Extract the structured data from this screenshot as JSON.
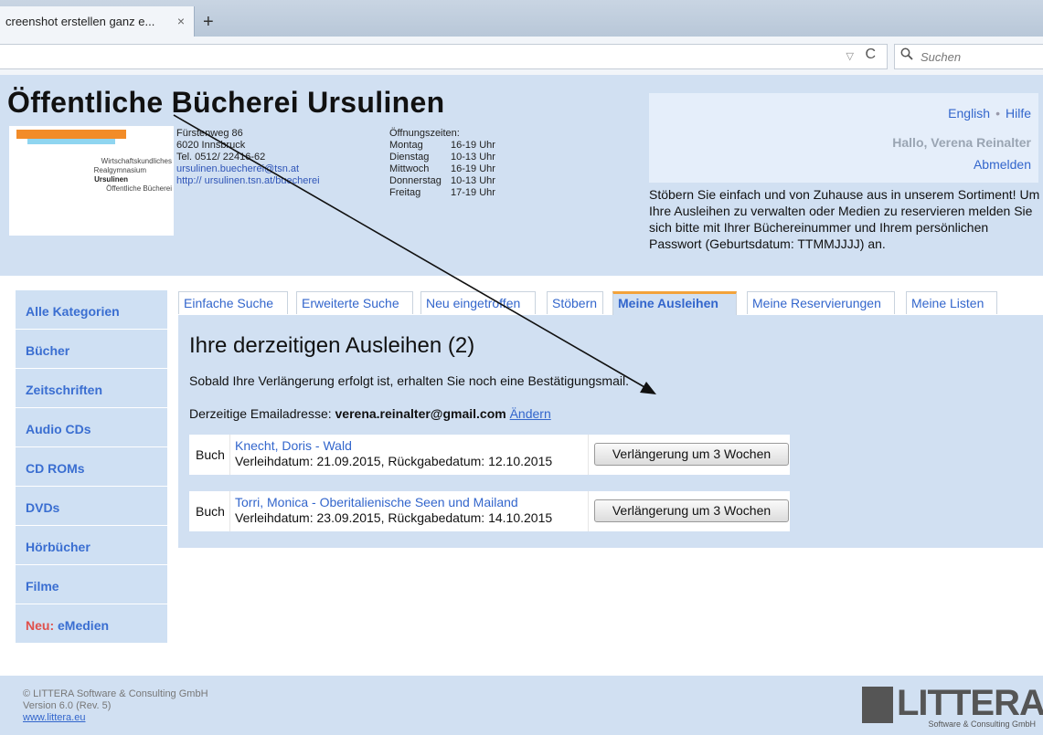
{
  "browser": {
    "tab_title": "creenshot erstellen ganz e...",
    "tab_close": "×",
    "new_tab": "+",
    "url_dropdown": "▽",
    "reload": "C",
    "search_placeholder": "Suchen",
    "search_icon": "search-icon"
  },
  "header": {
    "title": "Öffentliche Bücherei Ursulinen",
    "logo_lines": [
      "Wirtschaftskundliches",
      "Realgymnasium",
      "Ursulinen",
      "Öffentliche Bücherei"
    ],
    "address": [
      "Fürstenweg 86",
      "6020 Innsbruck",
      "Tel. 0512/ 22416-62"
    ],
    "email": "ursulinen.buecherei@tsn.at",
    "web": "http:// ursulinen.tsn.at/buecherei",
    "hours_label": "Öffnungszeiten:",
    "hours": [
      {
        "day": "Montag",
        "time": "16-19 Uhr"
      },
      {
        "day": "Dienstag",
        "time": "10-13 Uhr"
      },
      {
        "day": "Mittwoch",
        "time": "16-19 Uhr"
      },
      {
        "day": "Donnerstag",
        "time": "10-13 Uhr"
      },
      {
        "day": "Freitag",
        "time": "17-19 Uhr"
      }
    ],
    "lang_english": "English",
    "lang_sep": "•",
    "help": "Hilfe",
    "greeting": "Hallo, Verena Reinalter",
    "logout": "Abmelden",
    "intro": "Stöbern Sie einfach und von Zuhause aus in unserem Sortiment!  Um Ihre Ausleihen zu verwalten oder Medien zu reservieren melden Sie sich bitte mit Ihrer Büchereinummer und Ihrem persönlichen Passwort (Geburtsdatum: TTMMJJJJ) an."
  },
  "sidebar": {
    "items": [
      {
        "label": "Alle Kategorien"
      },
      {
        "label": "Bücher"
      },
      {
        "label": "Zeitschriften"
      },
      {
        "label": "Audio CDs"
      },
      {
        "label": "CD ROMs"
      },
      {
        "label": "DVDs"
      },
      {
        "label": "Hörbücher"
      },
      {
        "label": "Filme"
      }
    ],
    "new_prefix": "Neu:",
    "new_label": "eMedien"
  },
  "tabs": [
    {
      "label": "Einfache Suche"
    },
    {
      "label": "Erweiterte Suche"
    },
    {
      "label": "Neu eingetroffen"
    },
    {
      "label": "Stöbern"
    },
    {
      "label": "Meine Ausleihen"
    },
    {
      "label": "Meine Reservierungen"
    },
    {
      "label": "Meine Listen"
    }
  ],
  "main": {
    "heading": "Ihre derzeitigen Ausleihen (2)",
    "notice": "Sobald Ihre Verlängerung erfolgt ist, erhalten Sie noch eine Bestätigungsmail.",
    "email_label": "Derzeitige Emailadresse:",
    "email": "verena.reinalter@gmail.com",
    "change": "Ändern",
    "loans": [
      {
        "type": "Buch",
        "title": "Knecht, Doris - Wald",
        "dates": "Verleihdatum: 21.09.2015, Rückgabedatum: 12.10.2015",
        "button": "Verlängerung um 3 Wochen"
      },
      {
        "type": "Buch",
        "title": "Torri, Monica - Oberitalienische Seen und Mailand",
        "dates": "Verleihdatum: 23.09.2015, Rückgabedatum: 14.10.2015",
        "button": "Verlängerung um 3 Wochen"
      }
    ]
  },
  "footer": {
    "copyright": "© LITTERA Software & Consulting GmbH",
    "version": "Version 6.0 (Rev. 5)",
    "link": "www.littera.eu",
    "logo_word": "LITTERA",
    "logo_sub": "Software & Consulting GmbH"
  }
}
